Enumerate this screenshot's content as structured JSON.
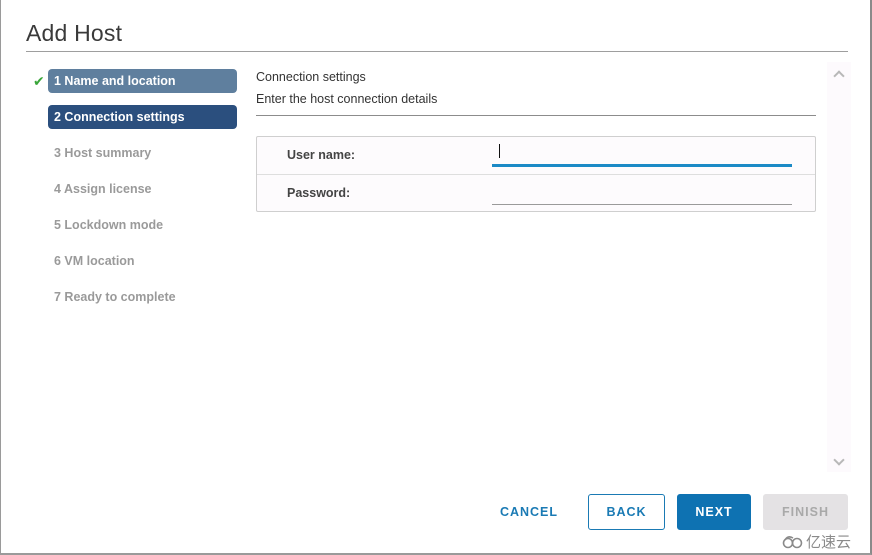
{
  "dialog": {
    "title": "Add Host"
  },
  "steps": [
    {
      "label": "1 Name and location",
      "state": "done"
    },
    {
      "label": "2 Connection settings",
      "state": "active"
    },
    {
      "label": "3 Host summary",
      "state": "pending"
    },
    {
      "label": "4 Assign license",
      "state": "pending"
    },
    {
      "label": "5 Lockdown mode",
      "state": "pending"
    },
    {
      "label": "6 VM location",
      "state": "pending"
    },
    {
      "label": "7 Ready to complete",
      "state": "pending"
    }
  ],
  "content": {
    "section_title": "Connection settings",
    "section_desc": "Enter the host connection details",
    "fields": {
      "username": {
        "label": "User name:",
        "value": ""
      },
      "password": {
        "label": "Password:",
        "value": ""
      }
    }
  },
  "footer": {
    "cancel": "CANCEL",
    "back": "BACK",
    "next": "NEXT",
    "finish": "FINISH"
  },
  "watermark": {
    "text": "亿速云"
  },
  "colors": {
    "step_done": "#5f7f9e",
    "step_active": "#2b4f7e",
    "primary": "#0e72b2",
    "focus_underline": "#1b8ac6",
    "check": "#3aa63a"
  }
}
